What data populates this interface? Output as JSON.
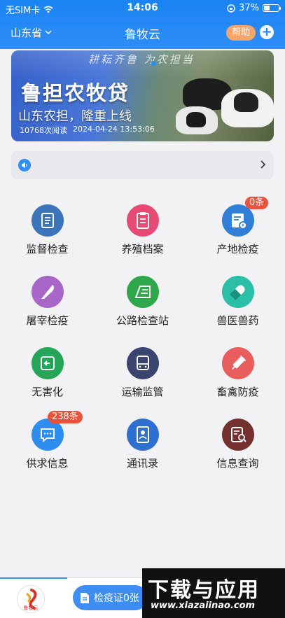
{
  "status_bar": {
    "carrier": "无SIM卡",
    "time": "14:06",
    "battery": "37%"
  },
  "header": {
    "region": "山东省",
    "title": "鲁牧云",
    "help_label": "帮助",
    "add_icon": "plus-circle-icon",
    "colors": {
      "bar": "#1a84f3",
      "help": "#f5a46a"
    }
  },
  "banner": {
    "art_slogan": "耕耘齐鲁 为农担当",
    "loan_title": "鲁担农牧贷",
    "headline": "山东农担，隆重上线",
    "reads": "10768次阅读",
    "date": "2024-04-24 13:53:06"
  },
  "notice": {
    "icon": "speaker-icon",
    "chevron": "chevron-right-icon"
  },
  "modules": [
    {
      "label": "监督检查",
      "icon": "document-scroll-icon",
      "color": "#3b74b8"
    },
    {
      "label": "养殖档案",
      "icon": "clipboard-icon",
      "color": "#e84a76"
    },
    {
      "label": "产地检疫",
      "icon": "certificate-icon",
      "color": "#2f7fd9",
      "badge": "0条"
    },
    {
      "label": "屠宰检疫",
      "icon": "knife-icon",
      "color": "#a867c8"
    },
    {
      "label": "公路检查站",
      "icon": "checkpoint-icon",
      "color": "#2ea84a"
    },
    {
      "label": "兽医兽药",
      "icon": "capsule-icon",
      "color": "#2bbfa8"
    },
    {
      "label": "无害化",
      "icon": "exit-icon",
      "color": "#24a558"
    },
    {
      "label": "运输监管",
      "icon": "bus-icon",
      "color": "#39446f"
    },
    {
      "label": "畜禽防疫",
      "icon": "syringe-icon",
      "color": "#ea5d5d"
    },
    {
      "label": "供求信息",
      "icon": "chat-bubble-icon",
      "color": "#2e8ef0",
      "badge": "238条"
    },
    {
      "label": "通讯录",
      "icon": "contacts-icon",
      "color": "#2e6fd0"
    },
    {
      "label": "信息查询",
      "icon": "search-document-icon",
      "color": "#74302f"
    }
  ],
  "bottom_bar": {
    "logo_text": "鲁牧云",
    "cert_label": "检疫证0张"
  },
  "watermark": {
    "title": "下载与应用",
    "url": "www.xiazaiinao.com"
  }
}
